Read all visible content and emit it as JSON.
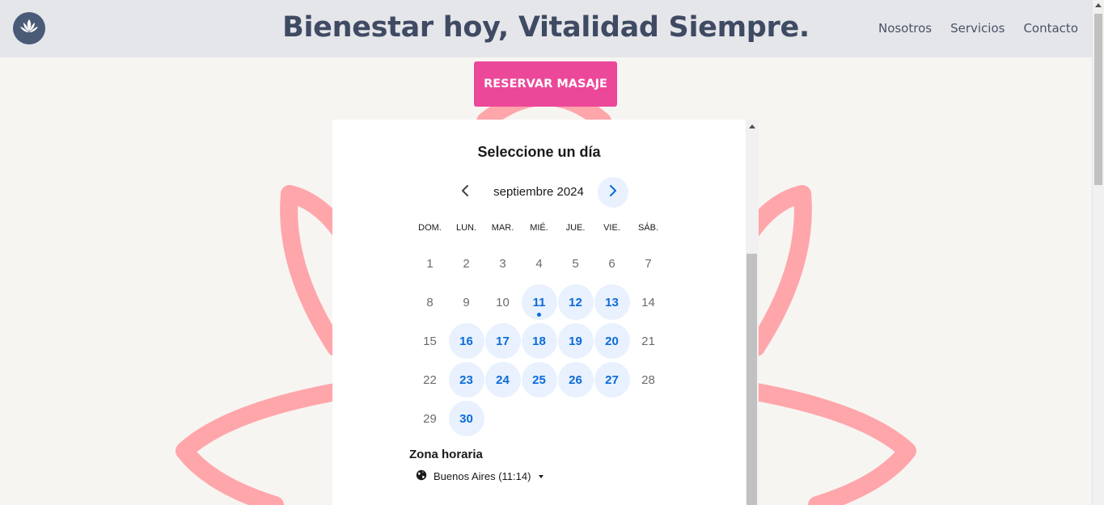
{
  "header": {
    "title": "Bienestar hoy, Vitalidad Siempre.",
    "logo_icon": "lotus-icon",
    "nav": [
      "Nosotros",
      "Servicios",
      "Contacto"
    ]
  },
  "cta": {
    "label": "RESERVAR MASAJE"
  },
  "booking": {
    "title": "Seleccione un día",
    "month": "septiembre 2024",
    "weekdays": [
      "DOM.",
      "LUN.",
      "MAR.",
      "MIÉ.",
      "JUE.",
      "VIE.",
      "SÁB."
    ],
    "weeks": [
      [
        {
          "d": "1"
        },
        {
          "d": "2"
        },
        {
          "d": "3"
        },
        {
          "d": "4"
        },
        {
          "d": "5"
        },
        {
          "d": "6"
        },
        {
          "d": "7"
        }
      ],
      [
        {
          "d": "8"
        },
        {
          "d": "9"
        },
        {
          "d": "10"
        },
        {
          "d": "11",
          "available": true,
          "today": true
        },
        {
          "d": "12",
          "available": true
        },
        {
          "d": "13",
          "available": true
        },
        {
          "d": "14"
        }
      ],
      [
        {
          "d": "15"
        },
        {
          "d": "16",
          "available": true
        },
        {
          "d": "17",
          "available": true
        },
        {
          "d": "18",
          "available": true
        },
        {
          "d": "19",
          "available": true
        },
        {
          "d": "20",
          "available": true
        },
        {
          "d": "21"
        }
      ],
      [
        {
          "d": "22"
        },
        {
          "d": "23",
          "available": true
        },
        {
          "d": "24",
          "available": true
        },
        {
          "d": "25",
          "available": true
        },
        {
          "d": "26",
          "available": true
        },
        {
          "d": "27",
          "available": true
        },
        {
          "d": "28"
        }
      ],
      [
        {
          "d": "29"
        },
        {
          "d": "30",
          "available": true
        }
      ]
    ],
    "timezone_title": "Zona horaria",
    "timezone_value": "Buenos Aires (11:14)"
  },
  "colors": {
    "accent": "#ec4899",
    "available_bg": "#e8f1fd",
    "available_text": "#0b6bdb",
    "header_bg": "#e5e6ea",
    "lotus": "#ffa6ab"
  }
}
